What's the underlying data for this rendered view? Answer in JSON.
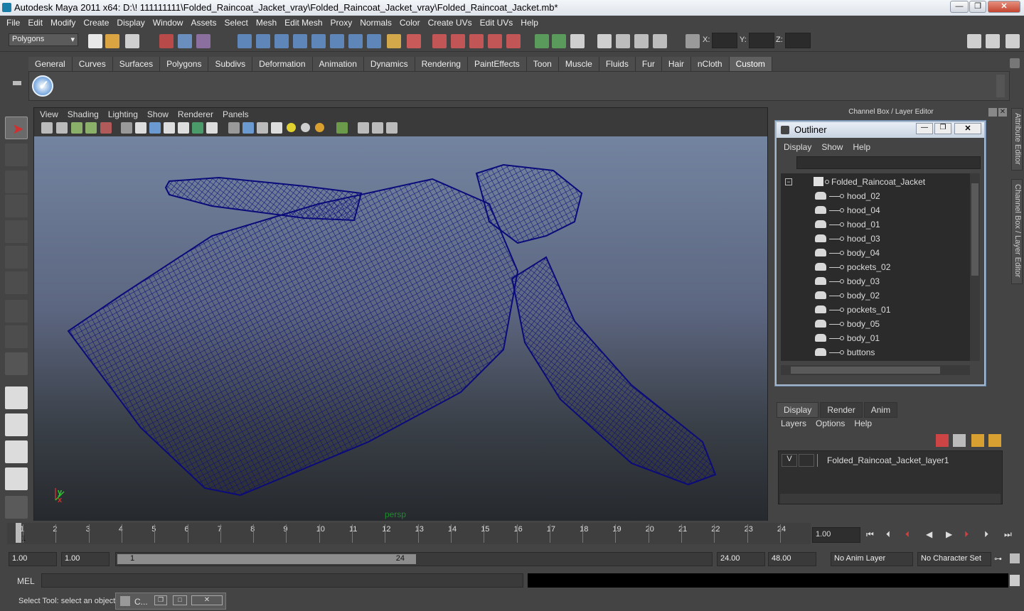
{
  "window": {
    "title": "Autodesk Maya 2011 x64: D:\\! 111111111\\Folded_Raincoat_Jacket_vray\\Folded_Raincoat_Jacket_vray\\Folded_Raincoat_Jacket.mb*",
    "min": "—",
    "max": "❐",
    "close": "✕"
  },
  "menu": [
    "File",
    "Edit",
    "Modify",
    "Create",
    "Display",
    "Window",
    "Assets",
    "Select",
    "Mesh",
    "Edit Mesh",
    "Proxy",
    "Normals",
    "Color",
    "Create UVs",
    "Edit UVs",
    "Help"
  ],
  "status": {
    "mode": "Polygons",
    "x_label": "X:",
    "y_label": "Y:",
    "z_label": "Z:"
  },
  "shelf_tabs": [
    "General",
    "Curves",
    "Surfaces",
    "Polygons",
    "Subdivs",
    "Deformation",
    "Animation",
    "Dynamics",
    "Rendering",
    "PaintEffects",
    "Toon",
    "Muscle",
    "Fluids",
    "Fur",
    "Hair",
    "nCloth",
    "Custom"
  ],
  "shelf_active": "Custom",
  "viewport": {
    "menu": [
      "View",
      "Shading",
      "Lighting",
      "Show",
      "Renderer",
      "Panels"
    ],
    "camera": "persp",
    "wire_color": "#0b0b7a",
    "axis_y": "y",
    "axis_x": "x"
  },
  "channelbox_title": "Channel Box / Layer Editor",
  "outliner": {
    "title": "Outliner",
    "menu": [
      "Display",
      "Show",
      "Help"
    ],
    "root": "Folded_Raincoat_Jacket",
    "items": [
      "hood_02",
      "hood_04",
      "hood_01",
      "hood_03",
      "body_04",
      "pockets_02",
      "body_03",
      "body_02",
      "pockets_01",
      "body_05",
      "body_01",
      "buttons"
    ]
  },
  "layers": {
    "tabs": [
      "Display",
      "Render",
      "Anim"
    ],
    "menu": [
      "Layers",
      "Options",
      "Help"
    ],
    "visible": "V",
    "layer_name": "Folded_Raincoat_Jacket_layer1"
  },
  "sidetabs": [
    "Attribute Editor",
    "Channel Box / Layer Editor"
  ],
  "timeline": {
    "ticks": [
      "1",
      "2",
      "3",
      "4",
      "5",
      "6",
      "7",
      "8",
      "9",
      "10",
      "11",
      "12",
      "13",
      "14",
      "15",
      "16",
      "17",
      "18",
      "19",
      "20",
      "21",
      "22",
      "23",
      "24"
    ],
    "current": "1",
    "current_field": "1.00"
  },
  "range": {
    "start": "1.00",
    "inner_start": "1.00",
    "slider_start": "1",
    "slider_end": "24",
    "end": "24.00",
    "out": "48.00",
    "anim_layer": "No Anim Layer",
    "char_set": "No Character Set"
  },
  "cmd": {
    "label": "MEL"
  },
  "help": {
    "text": "Select Tool: select an object",
    "taskbar": "C..."
  }
}
